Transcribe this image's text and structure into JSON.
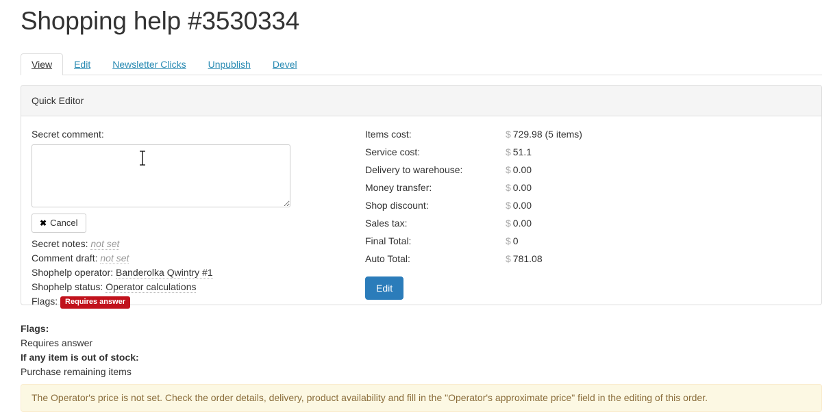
{
  "header": {
    "title": "Shopping help #3530334"
  },
  "tabs": [
    {
      "label": "View",
      "active": true
    },
    {
      "label": "Edit",
      "active": false
    },
    {
      "label": "Newsletter Clicks",
      "active": false
    },
    {
      "label": "Unpublish",
      "active": false
    },
    {
      "label": "Devel",
      "active": false
    }
  ],
  "panel": {
    "title": "Quick Editor",
    "secret_comment": {
      "label": "Secret comment:",
      "value": "",
      "placeholder": ""
    },
    "cancel_button": {
      "icon": "close-x-icon",
      "label": "Cancel"
    },
    "meta": [
      {
        "label": "Secret notes:",
        "value": "not set",
        "not_set": true
      },
      {
        "label": "Comment draft:",
        "value": "not set",
        "not_set": true
      },
      {
        "label": "Shophelp operator:",
        "value": "Banderolka Qwintry #1",
        "not_set": false
      },
      {
        "label": "Shophelp status:",
        "value": "Operator calculations",
        "not_set": false
      }
    ],
    "flags_inline": {
      "label": "Flags:",
      "badge": "Requires answer",
      "badge_color": "#c1121c"
    },
    "costs": [
      {
        "label": "Items cost:",
        "currency": "$",
        "value": "729.98 (5 items)"
      },
      {
        "label": "Service cost:",
        "currency": "$",
        "value": "51.1"
      },
      {
        "label": "Delivery to warehouse:",
        "currency": "$",
        "value": "0.00"
      },
      {
        "label": "Money transfer:",
        "currency": "$",
        "value": "0.00"
      },
      {
        "label": "Shop discount:",
        "currency": "$",
        "value": "0.00"
      },
      {
        "label": "Sales tax:",
        "currency": "$",
        "value": "0.00"
      },
      {
        "label": "Final Total:",
        "currency": "$",
        "value": "0"
      },
      {
        "label": "Auto Total:",
        "currency": "$",
        "value": "781.08"
      }
    ],
    "edit_button": {
      "label": "Edit",
      "color": "#2b7cba"
    }
  },
  "flags_section": {
    "flags_heading": "Flags:",
    "flags_value": "Requires answer",
    "stock_heading": "If any item is out of stock:",
    "stock_value": "Purchase remaining items"
  },
  "alert": {
    "text": "The Operator's price is not set. Check the order details, delivery, product availability and fill in the \"Operator's approximate price\" field in the editing of this order.",
    "background": "#fcf8e3",
    "text_color": "#8a6d3b"
  }
}
